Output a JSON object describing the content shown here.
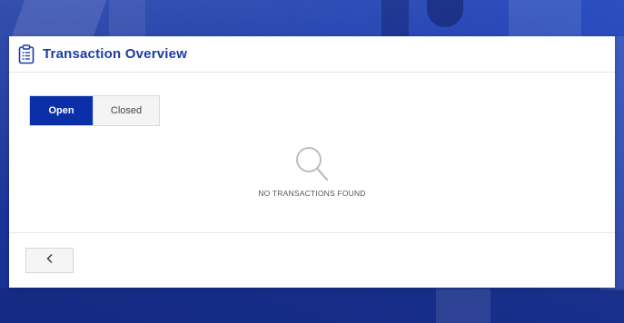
{
  "header": {
    "title": "Transaction Overview",
    "icon": "clipboard-list-icon"
  },
  "tabs": [
    {
      "label": "Open",
      "active": true
    },
    {
      "label": "Closed",
      "active": false
    }
  ],
  "empty_state": {
    "icon": "magnifier-icon",
    "message": "NO TRANSACTIONS FOUND"
  },
  "footer": {
    "back_icon": "chevron-left-icon"
  },
  "colors": {
    "accent": "#0b2fa8",
    "title": "#1a3ba6",
    "background": "#1f3fa8"
  }
}
